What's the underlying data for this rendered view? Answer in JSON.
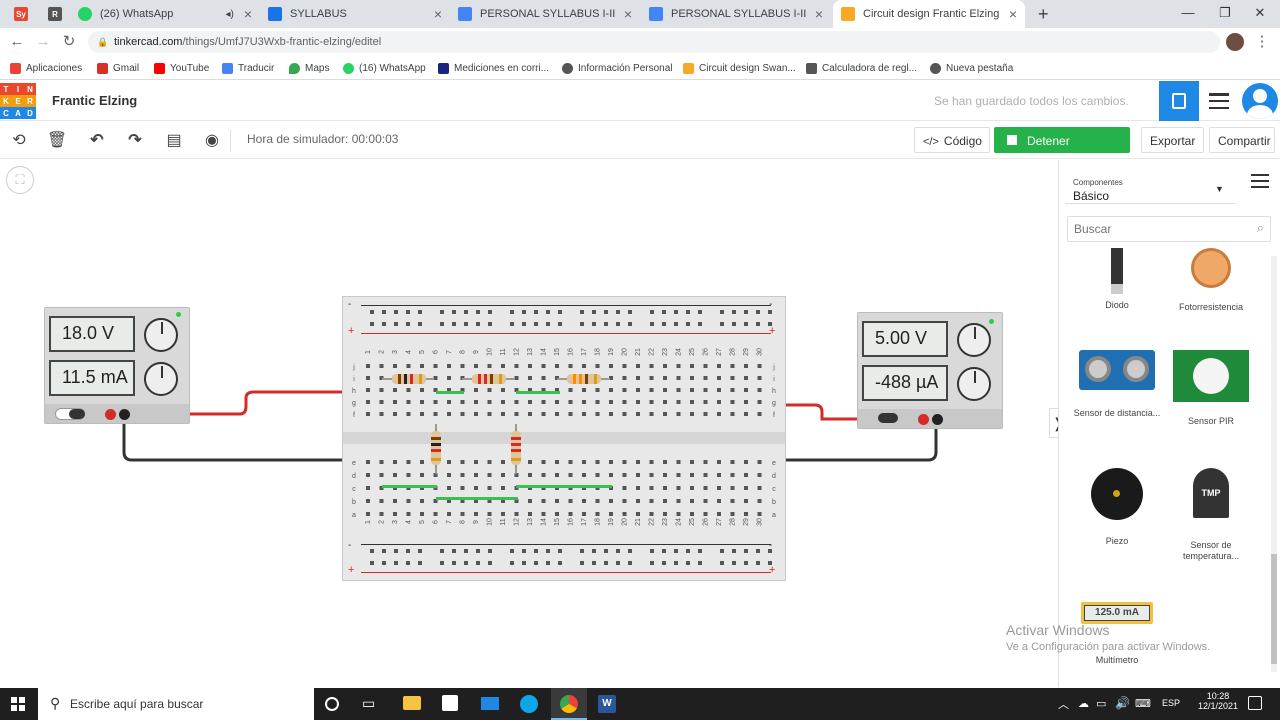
{
  "browser": {
    "tabs": [
      {
        "title": "",
        "icon": "sy-icon",
        "color": "#e34a33",
        "glyph": "Sy"
      },
      {
        "title": "",
        "icon": "r-icon",
        "color": "#555555",
        "glyph": "R"
      },
      {
        "title": "(26) WhatsApp",
        "icon": "whatsapp-icon",
        "color": "#25d366",
        "glyph": ""
      },
      {
        "title": "SYLLABUS",
        "icon": "classroom-icon",
        "color": "#1a73e8",
        "glyph": ""
      },
      {
        "title": "PERSONAL SYLLABUS I-II MSc.M",
        "icon": "docs-icon",
        "color": "#4285f4",
        "glyph": ""
      },
      {
        "title": "PERSONAL SYLLABUS I-II MSc.M",
        "icon": "docs-icon",
        "color": "#4285f4",
        "glyph": ""
      },
      {
        "title": "Circuit design Frantic Elzing | Tin",
        "icon": "tinkercad-icon",
        "color": "#f9a825",
        "glyph": ""
      }
    ],
    "url_host": "tinkercad.com",
    "url_path": "/things/UmfJ7U3Wxb-frantic-elzing/editel",
    "bookmarks": [
      {
        "label": "Aplicaciones",
        "color": "#ea4335"
      },
      {
        "label": "Gmail",
        "color": "#d93025"
      },
      {
        "label": "YouTube",
        "color": "#ff0000"
      },
      {
        "label": "Traducir",
        "color": "#4285f4"
      },
      {
        "label": "Maps",
        "color": "#34a853"
      },
      {
        "label": "(16) WhatsApp",
        "color": "#25d366"
      },
      {
        "label": "Mediciones en corri...",
        "color": "#1a237e"
      },
      {
        "label": "Información Personal",
        "color": "#555555"
      },
      {
        "label": "Circuit design Swan...",
        "color": "#f9a825"
      },
      {
        "label": "Calculadora de regl...",
        "color": "#555555"
      },
      {
        "label": "Nueva pestaña",
        "color": "#555555"
      }
    ]
  },
  "app": {
    "logo_letters": [
      "T",
      "I",
      "N",
      "K",
      "E",
      "R",
      "C",
      "A",
      "D"
    ],
    "project_name": "Frantic Elzing",
    "save_status": "Se han guardado todos los cambios.",
    "sim_time": "Hora de simulador: 00:00:03",
    "code_label": "Código",
    "stop_sim_label": "Detener simulación",
    "export_label": "Exportar",
    "share_label": "Compartir"
  },
  "panel": {
    "category_caption": "Componentes",
    "category_value": "Básico",
    "search_placeholder": "Buscar",
    "components": [
      "Diodo",
      "Fotorresistencia",
      "Sensor de distancia...",
      "Sensor PIR",
      "Piezo",
      "Sensor de temperatura...",
      "Multímetro"
    ],
    "tmp_label": "TMP",
    "multimeter_reading": "125.0 mA"
  },
  "circuit": {
    "psu_left": {
      "voltage": "18.0 V",
      "current": "11.5 mA"
    },
    "psu_right": {
      "voltage": "5.00 V",
      "current": "-488 µA"
    },
    "breadboard": {
      "column_numbers": [
        "1",
        "2",
        "3",
        "4",
        "5",
        "6",
        "7",
        "8",
        "9",
        "10",
        "11",
        "12",
        "13",
        "14",
        "15",
        "16",
        "17",
        "18",
        "19",
        "20",
        "21",
        "22",
        "23",
        "24",
        "25",
        "26",
        "27",
        "28",
        "29",
        "30"
      ],
      "rows_top": [
        "j",
        "i",
        "h",
        "g",
        "f"
      ],
      "rows_bottom": [
        "e",
        "d",
        "c",
        "b",
        "a"
      ],
      "plus": "+",
      "minus": "-"
    }
  },
  "watermark": {
    "title": "Activar Windows",
    "subtitle": "Ve a Configuración para activar Windows."
  },
  "taskbar": {
    "search_placeholder": "Escribe aquí para buscar",
    "language": "ESP",
    "time": "10:28",
    "date": "12/1/2021"
  }
}
